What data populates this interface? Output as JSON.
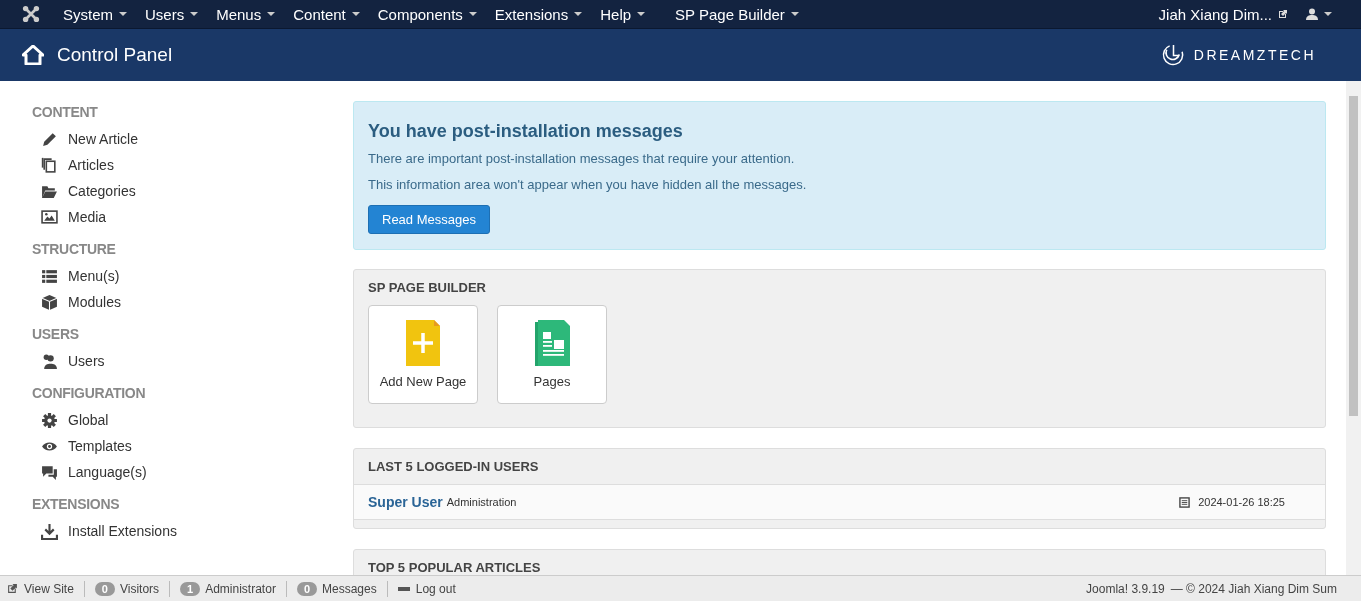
{
  "menu": {
    "items": [
      {
        "label": "System"
      },
      {
        "label": "Users"
      },
      {
        "label": "Menus"
      },
      {
        "label": "Content"
      },
      {
        "label": "Components"
      },
      {
        "label": "Extensions"
      },
      {
        "label": "Help"
      },
      {
        "label": "SP Page Builder"
      }
    ],
    "site_link": "Jiah Xiang Dim..."
  },
  "header": {
    "title": "Control Panel",
    "logo": "DREAMZTECH"
  },
  "sidebar": {
    "sections": [
      {
        "heading": "CONTENT",
        "items": [
          {
            "label": "New Article",
            "kind": "pencil"
          },
          {
            "label": "Articles",
            "kind": "copies"
          },
          {
            "label": "Categories",
            "kind": "folder"
          },
          {
            "label": "Media",
            "kind": "image"
          }
        ]
      },
      {
        "heading": "STRUCTURE",
        "items": [
          {
            "label": "Menu(s)",
            "kind": "list"
          },
          {
            "label": "Modules",
            "kind": "cube"
          }
        ]
      },
      {
        "heading": "USERS",
        "items": [
          {
            "label": "Users",
            "kind": "users"
          }
        ]
      },
      {
        "heading": "CONFIGURATION",
        "items": [
          {
            "label": "Global",
            "kind": "gear"
          },
          {
            "label": "Templates",
            "kind": "eye"
          },
          {
            "label": "Language(s)",
            "kind": "chat"
          }
        ]
      },
      {
        "heading": "EXTENSIONS",
        "items": [
          {
            "label": "Install Extensions",
            "kind": "download"
          }
        ]
      }
    ]
  },
  "alert": {
    "title": "You have post-installation messages",
    "lines": [
      "There are important post-installation messages that require your attention.",
      "This information area won't appear when you have hidden all the messages."
    ],
    "button": "Read Messages"
  },
  "page_builder": {
    "heading": "SP PAGE BUILDER",
    "tiles": [
      {
        "label": "Add New Page",
        "kind": "add"
      },
      {
        "label": "Pages",
        "kind": "pages"
      }
    ]
  },
  "logged_in": {
    "heading": "LAST 5 LOGGED-IN USERS",
    "rows": [
      {
        "name": "Super User",
        "role": "Administration",
        "time": "2024-01-26 18:25"
      }
    ]
  },
  "popular": {
    "heading": "TOP 5 POPULAR ARTICLES"
  },
  "status_bar": {
    "items": [
      {
        "kind": "link",
        "label": "View Site"
      },
      {
        "kind": "count",
        "count": "0",
        "label": "Visitors"
      },
      {
        "kind": "count",
        "count": "1",
        "label": "Administrator"
      },
      {
        "kind": "count",
        "count": "0",
        "label": "Messages"
      },
      {
        "kind": "logout",
        "label": "Log out"
      }
    ],
    "version": "Joomla! 3.9.19",
    "copyright": "— © 2024 Jiah Xiang Dim Sum"
  }
}
